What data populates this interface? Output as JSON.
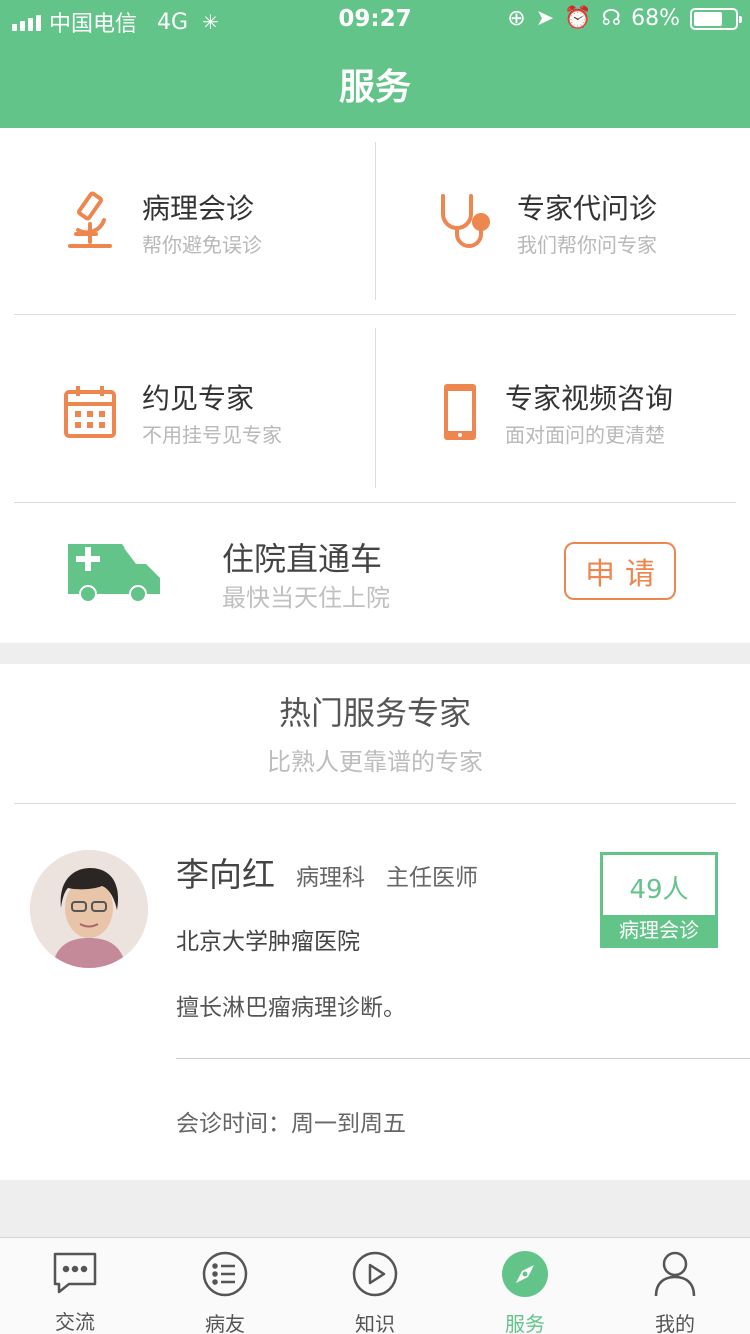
{
  "status_bar": {
    "carrier": "中国电信",
    "network": "4G",
    "time": "09:27",
    "battery": "68%"
  },
  "header": {
    "title": "服务"
  },
  "services": [
    {
      "title": "病理会诊",
      "subtitle": "帮你避免误诊",
      "icon": "microscope-icon"
    },
    {
      "title": "专家代问诊",
      "subtitle": "我们帮你问专家",
      "icon": "stethoscope-icon"
    },
    {
      "title": "约见专家",
      "subtitle": "不用挂号见专家",
      "icon": "calendar-icon"
    },
    {
      "title": "专家视频咨询",
      "subtitle": "面对面问的更清楚",
      "icon": "phone-icon"
    }
  ],
  "hospital_express": {
    "title": "住院直通车",
    "subtitle": "最快当天住上院",
    "button": "申请",
    "icon": "ambulance-icon"
  },
  "experts_section": {
    "title": "热门服务专家",
    "subtitle": "比熟人更靠谱的专家",
    "expert": {
      "name": "李向红",
      "department": "病理科",
      "rank": "主任医师",
      "hospital": "北京大学肿瘤医院",
      "specialty": "擅长淋巴瘤病理诊断。",
      "schedule": "会诊时间：周一到周五",
      "badge_count": "49人",
      "badge_label": "病理会诊"
    }
  },
  "tabbar": [
    {
      "label": "交流",
      "icon": "chat-icon",
      "active": false
    },
    {
      "label": "病友",
      "icon": "list-icon",
      "active": false
    },
    {
      "label": "知识",
      "icon": "play-icon",
      "active": false
    },
    {
      "label": "服务",
      "icon": "compass-icon",
      "active": true
    },
    {
      "label": "我的",
      "icon": "person-icon",
      "active": false
    }
  ],
  "colors": {
    "brand_green": "#63c48a",
    "accent_orange": "#ee8650"
  }
}
